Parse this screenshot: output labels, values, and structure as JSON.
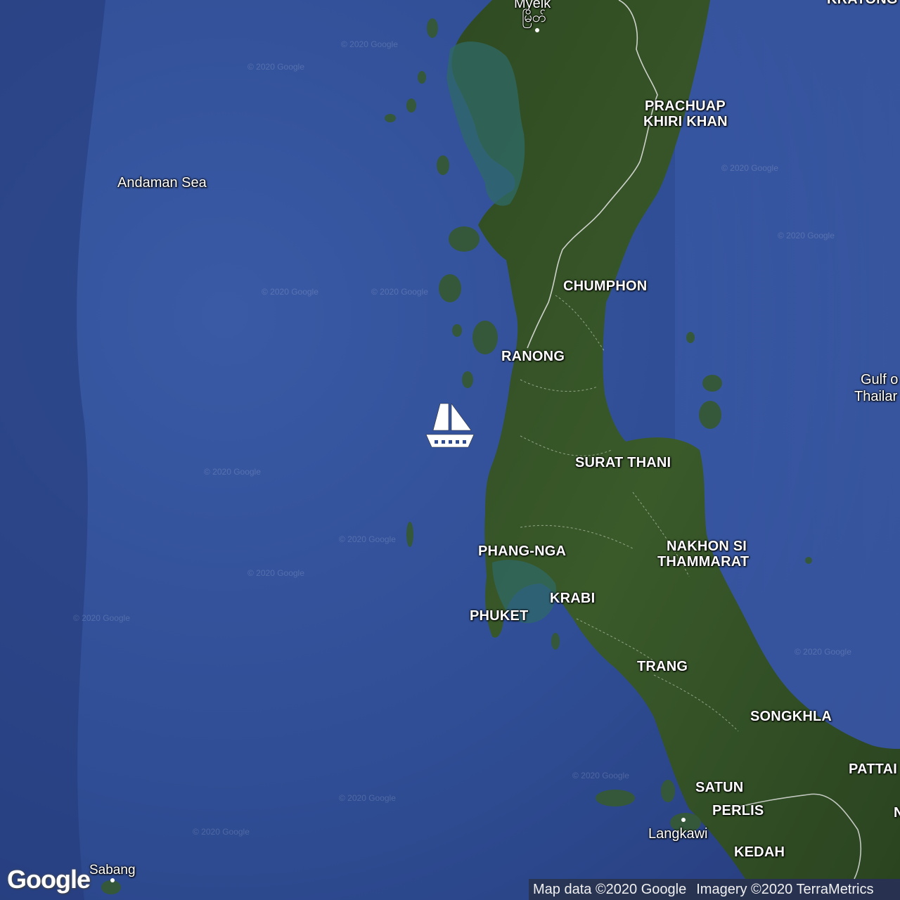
{
  "map": {
    "water_labels": {
      "andaman_sea": "Andaman Sea",
      "gulf_line1": "Gulf o",
      "gulf_line2": "Thailar"
    },
    "provinces": {
      "myeik": "Myeik",
      "myeik_local": "မြိတ်",
      "kratong": "KRATONG",
      "prachuap1": "PRACHUAP",
      "prachuap2": "KHIRI KHAN",
      "chumphon": "CHUMPHON",
      "ranong": "RANONG",
      "surat_thani": "SURAT THANI",
      "phang_nga": "PHANG-NGA",
      "nakhon1": "NAKHON SI",
      "nakhon2": "THAMMARAT",
      "krabi": "KRABI",
      "phuket": "PHUKET",
      "trang": "TRANG",
      "songkhla": "SONGKHLA",
      "pattani": "PATTAI",
      "satun": "SATUN",
      "perlis": "PERLIS",
      "kedah": "KEDAH",
      "n_edge": "N"
    },
    "towns": {
      "langkawi": "Langkawi",
      "sabang": "Sabang"
    },
    "watermark": "© 2020 Google",
    "marker_icon": "sailboat-icon",
    "logo": "Google",
    "attribution": {
      "map_data": "Map data ©2020 Google",
      "imagery": "Imagery ©2020 TerraMetrics"
    },
    "colors": {
      "sea": "#2f4a8e",
      "land": "#2e4a22",
      "label": "#ffffff"
    }
  }
}
